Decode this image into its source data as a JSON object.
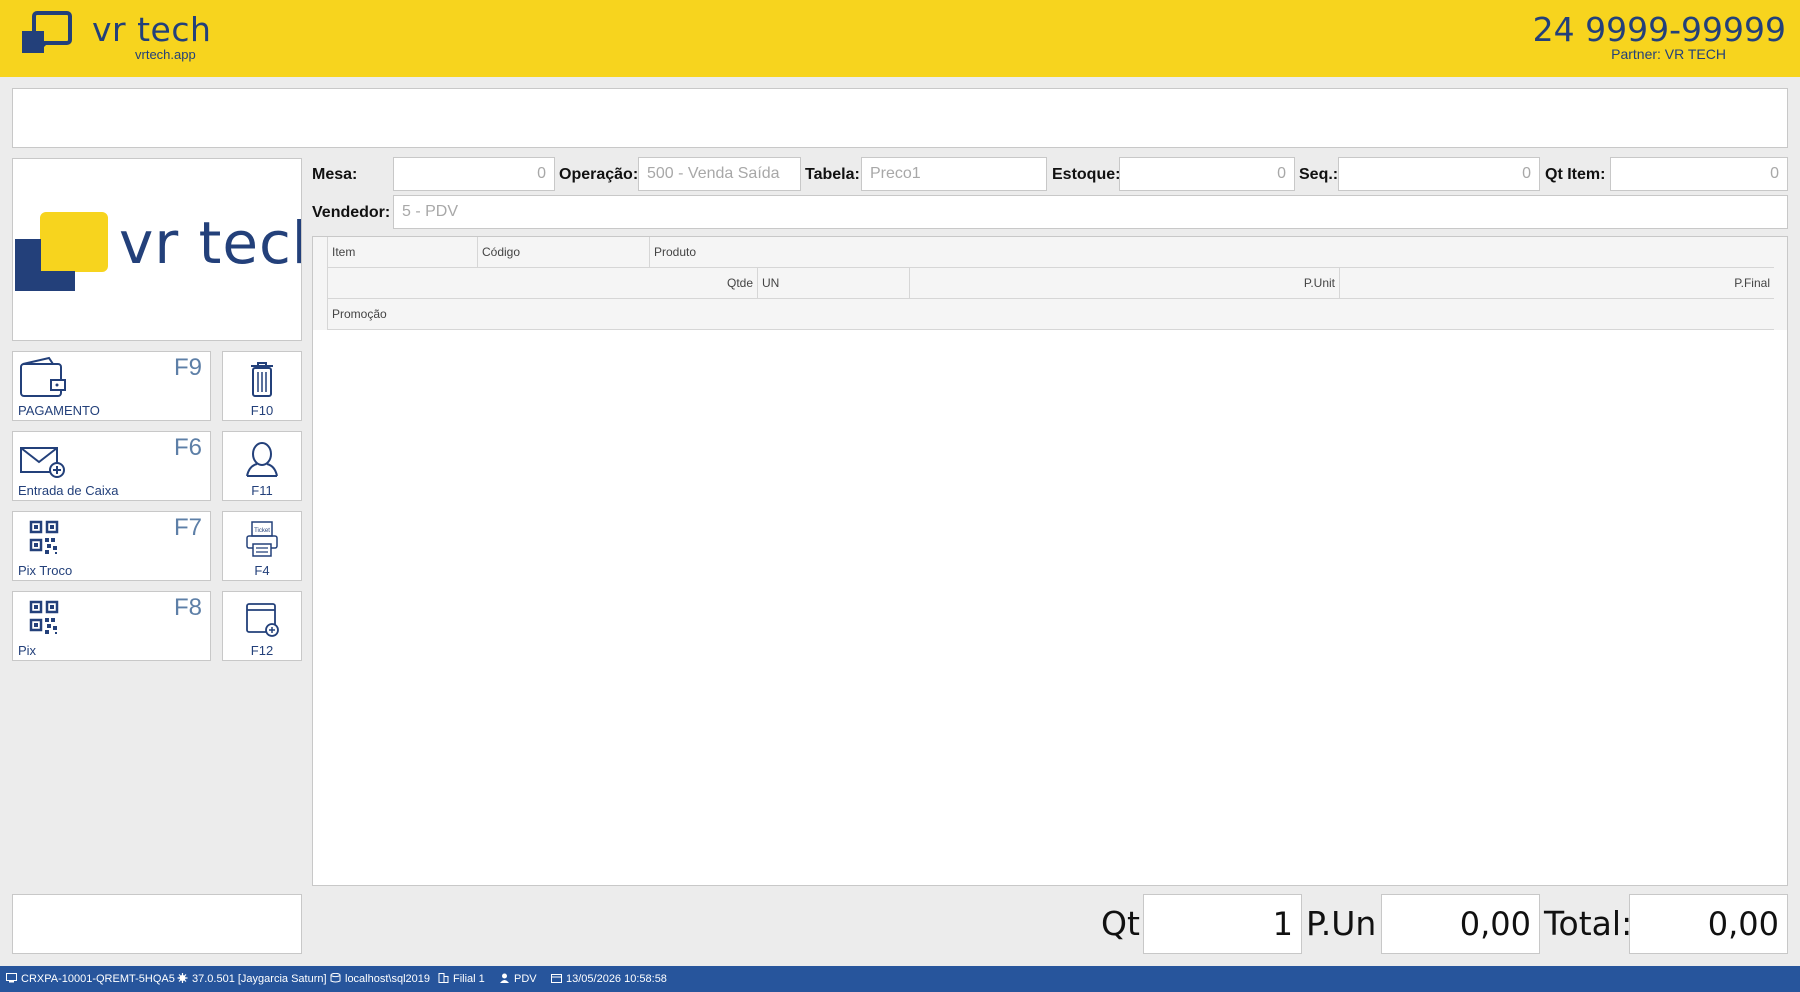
{
  "header": {
    "brand": "vr tech",
    "brand_sub": "vrtech.app",
    "phone": "24 9999-99999",
    "partner": "Partner: VR TECH"
  },
  "logo_panel": {
    "text": "vr tech"
  },
  "fields": {
    "mesa": {
      "label": "Mesa:",
      "value": "0"
    },
    "operacao": {
      "label": "Operação:",
      "value": "500 - Venda Saída"
    },
    "tabela": {
      "label": "Tabela:",
      "value": "Preco1"
    },
    "estoque": {
      "label": "Estoque:",
      "value": "0"
    },
    "seq": {
      "label": "Seq.:",
      "value": "0"
    },
    "qt_item": {
      "label": "Qt Item:",
      "value": "0"
    },
    "vendedor": {
      "label": "Vendedor:",
      "value": "5 - PDV"
    }
  },
  "function_buttons": [
    {
      "key": "F9",
      "label": "PAGAMENTO",
      "icon": "wallet-icon"
    },
    {
      "key": "F6",
      "label": "Entrada de Caixa",
      "icon": "envelope-add-icon"
    },
    {
      "key": "F7",
      "label": "Pix Troco",
      "icon": "qr-code-icon"
    },
    {
      "key": "F8",
      "label": "Pix",
      "icon": "qr-code-icon"
    }
  ],
  "side_buttons": [
    {
      "key": "F10",
      "icon": "trash-icon"
    },
    {
      "key": "F11",
      "icon": "person-icon"
    },
    {
      "key": "F4",
      "icon": "ticket-printer-icon",
      "icon_text": "Ticket"
    },
    {
      "key": "F12",
      "icon": "window-add-icon"
    }
  ],
  "grid": {
    "row1": [
      "Item",
      "Código",
      "Produto"
    ],
    "row2": [
      "Qtde",
      "UN",
      "P.Unit",
      "P.Final"
    ],
    "row3": [
      "Promoção"
    ]
  },
  "totals": {
    "qt_label": "Qt",
    "qt_value": "1",
    "pun_label": "P.Un",
    "pun_value": "0,00",
    "total_label": "Total:",
    "total_value": "0,00"
  },
  "status_bar": {
    "machine": "CRXPA-10001-QREMT-5HQA5",
    "version": "37.0.501 [Jaygarcia Saturn]",
    "server": "localhost\\sql2019",
    "filial": "Filial 1",
    "user": "PDV",
    "datetime": "13/05/2026 10:58:58"
  },
  "colors": {
    "header_bg": "#f7d41e",
    "brand_blue": "#23407a",
    "status_bg": "#27559c",
    "fkey_blue": "#5d7fa7"
  }
}
